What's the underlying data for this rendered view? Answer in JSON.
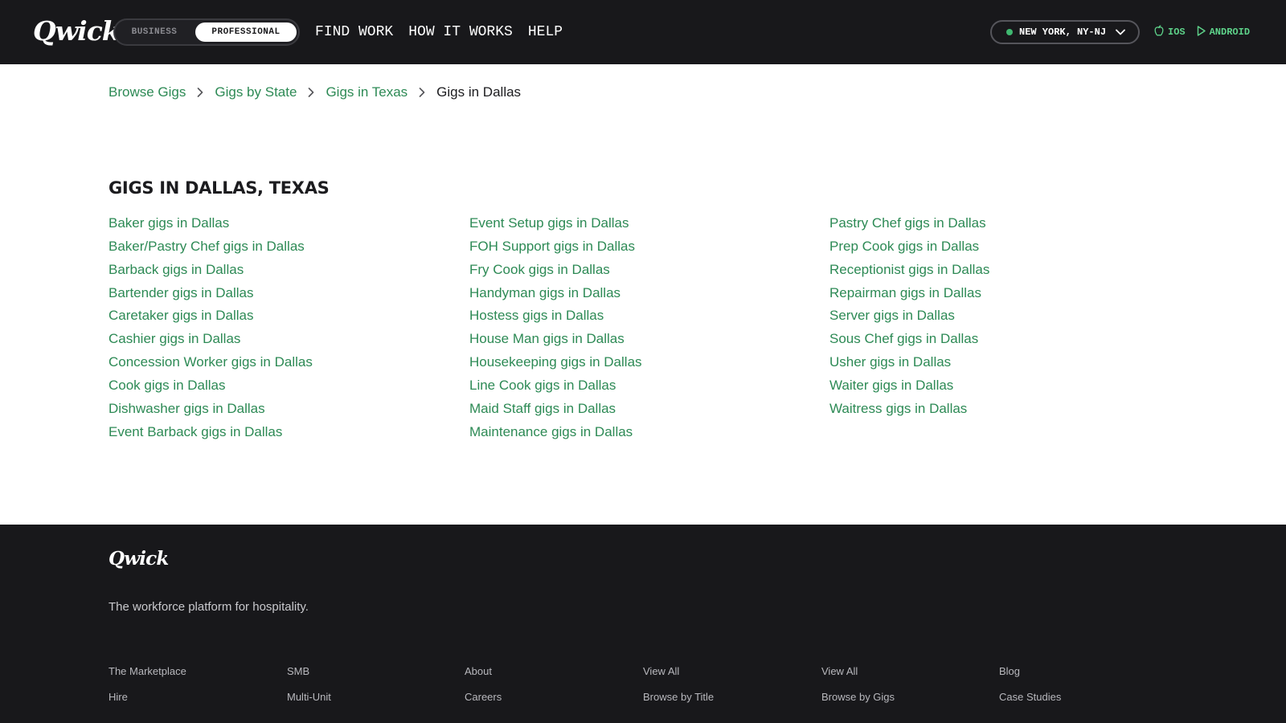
{
  "header": {
    "logo": "Qwick",
    "mode_toggle": {
      "business": "BUSINESS",
      "professional": "PROFESSIONAL",
      "selected": "PROFESSIONAL"
    },
    "nav": [
      "FIND WORK",
      "HOW IT WORKS",
      "HELP"
    ],
    "location": "NEW YORK, NY-NJ",
    "apps": {
      "ios": "IOS",
      "android": "ANDROID"
    }
  },
  "breadcrumb": {
    "items": [
      "Browse Gigs",
      "Gigs by State",
      "Gigs in Texas"
    ],
    "current": "Gigs in Dallas"
  },
  "main": {
    "title": "GIGS IN DALLAS, TEXAS",
    "columns": [
      [
        "Baker gigs in Dallas",
        "Baker/Pastry Chef gigs in Dallas",
        "Barback gigs in Dallas",
        "Bartender gigs in Dallas",
        "Caretaker gigs in Dallas",
        "Cashier gigs in Dallas",
        "Concession Worker gigs in Dallas",
        "Cook gigs in Dallas",
        "Dishwasher gigs in Dallas",
        "Event Barback gigs in Dallas"
      ],
      [
        "Event Setup gigs in Dallas",
        "FOH Support gigs in Dallas",
        "Fry Cook gigs in Dallas",
        "Handyman gigs in Dallas",
        "Hostess gigs in Dallas",
        "House Man gigs in Dallas",
        "Housekeeping gigs in Dallas",
        "Line Cook gigs in Dallas",
        "Maid Staff gigs in Dallas",
        "Maintenance gigs in Dallas"
      ],
      [
        "Pastry Chef gigs in Dallas",
        "Prep Cook gigs in Dallas",
        "Receptionist gigs in Dallas",
        "Repairman gigs in Dallas",
        "Server gigs in Dallas",
        "Sous Chef gigs in Dallas",
        "Usher gigs in Dallas",
        "Waiter gigs in Dallas",
        "Waitress gigs in Dallas"
      ]
    ]
  },
  "footer": {
    "logo": "Qwick",
    "tagline": "The workforce platform for hospitality.",
    "columns": [
      [
        "The Marketplace",
        "Hire"
      ],
      [
        "SMB",
        "Multi-Unit"
      ],
      [
        "About",
        "Careers"
      ],
      [
        "View All",
        "Browse by Title"
      ],
      [
        "View All",
        "Browse by Gigs"
      ],
      [
        "Blog",
        "Case Studies"
      ]
    ]
  },
  "colors": {
    "header_bg": "#18181b",
    "link_green": "#2d8a55",
    "app_green": "#5ed38a",
    "status_dot": "#3fb870"
  }
}
